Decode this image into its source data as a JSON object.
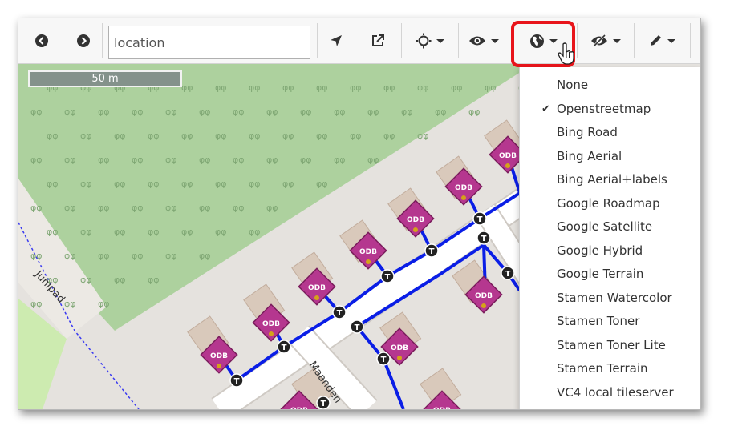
{
  "toolbar": {
    "back_icon": "arrow-left-circle-icon",
    "forward_icon": "arrow-right-circle-icon",
    "search_placeholder": "location",
    "locate_icon": "location-arrow-icon",
    "external_icon": "external-link-icon",
    "brightness_icon": "sun-icon",
    "visibility_icon": "eye-icon",
    "basemap_icon": "globe-icon",
    "hide_icon": "eye-slash-icon",
    "edit_icon": "pencil-icon",
    "highlight_color": "#e8151b"
  },
  "map": {
    "scale_label": "50 m",
    "street_labels": [
      "Junipad",
      "Maanden"
    ],
    "marker_label": "ODB",
    "node_label": "T",
    "colors": {
      "park": "#add19e",
      "road": "#ffffff",
      "ground": "#e5e2de",
      "building": "#d9c9bb",
      "network_line": "#0a1ee6",
      "marker": "#b5378f",
      "path_dashed": "#3a3af0",
      "grass_light": "#cdebb0"
    }
  },
  "dropdown": {
    "selected": "Openstreetmap",
    "items": [
      "None",
      "Openstreetmap",
      "Bing Road",
      "Bing Aerial",
      "Bing Aerial+labels",
      "Google Roadmap",
      "Google Satellite",
      "Google Hybrid",
      "Google Terrain",
      "Stamen Watercolor",
      "Stamen Toner",
      "Stamen Toner Lite",
      "Stamen Terrain",
      "VC4 local tileserver"
    ]
  }
}
